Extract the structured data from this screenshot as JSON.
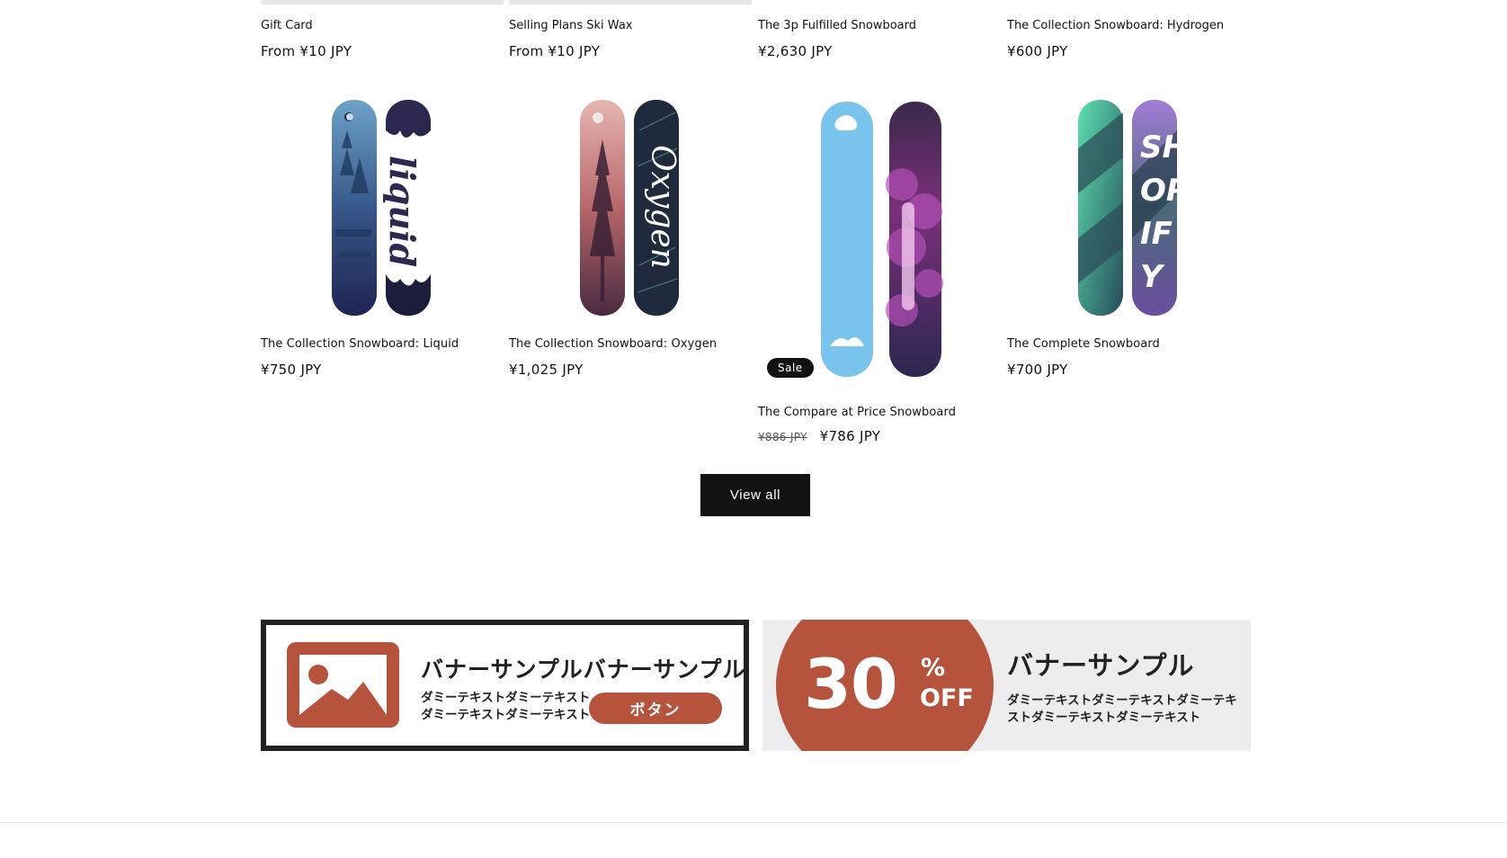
{
  "colors": {
    "text": "#121212",
    "button_bg": "#121212",
    "banner_accent": "#b5533c",
    "banner_bg": "#ededed"
  },
  "top_row": [
    {
      "title": "Gift Card",
      "price": "From ¥10 JPY"
    },
    {
      "title": "Selling Plans Ski Wax",
      "price": "From ¥10 JPY"
    },
    {
      "title": "The 3p Fulfilled Snowboard",
      "price": "¥2,630 JPY"
    },
    {
      "title": "The Collection Snowboard: Hydrogen",
      "price": "¥600 JPY"
    }
  ],
  "products": [
    {
      "title": "The Collection Snowboard: Liquid",
      "price": "¥750 JPY",
      "image": "liquid-snowboard"
    },
    {
      "title": "The Collection Snowboard: Oxygen",
      "price": "¥1,025 JPY",
      "image": "oxygen-snowboard"
    },
    {
      "title": "The Compare at Price Snowboard",
      "compare_price": "¥886 JPY",
      "price": "¥786 JPY",
      "badge": "Sale",
      "image": "compare-snowboard"
    },
    {
      "title": "The Complete Snowboard",
      "price": "¥700 JPY",
      "image": "complete-snowboard"
    }
  ],
  "view_all_label": "View all",
  "banners": {
    "left": {
      "headline": "バナーサンプルバナーサンプル",
      "body_line1": "ダミーテキストダミーテキスト",
      "body_line2": "ダミーテキストダミーテキスト",
      "button": "ボタン",
      "icon": "image-icon"
    },
    "right": {
      "number": "30",
      "percent": "%",
      "off": "OFF",
      "headline": "バナーサンプル",
      "body_line1": "ダミーテキストダミーテキストダミーテキ",
      "body_line2": "ストダミーテキストダミーテキスト"
    }
  }
}
